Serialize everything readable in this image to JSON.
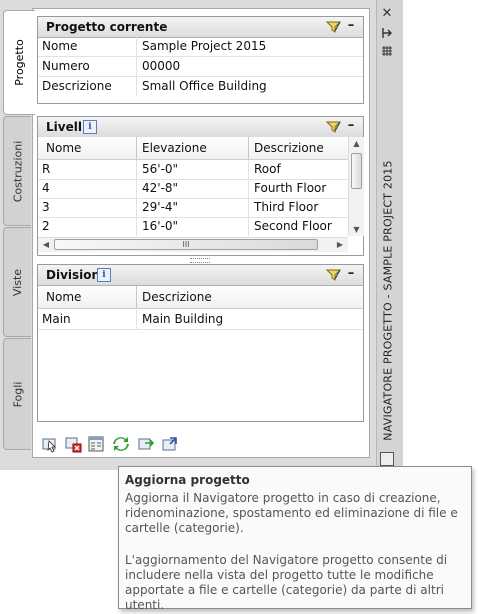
{
  "tabs": [
    {
      "label": "Progetto",
      "active": true
    },
    {
      "label": "Costruzioni",
      "active": false
    },
    {
      "label": "Viste",
      "active": false
    },
    {
      "label": "Fogli",
      "active": false
    }
  ],
  "palette_title": "NAVIGATORE PROGETTO - SAMPLE PROJECT 2015",
  "palette_icons": [
    "close-icon",
    "auto-hide-icon",
    "properties-icon"
  ],
  "current_project": {
    "title": "Progetto corrente",
    "rows": [
      {
        "key": "Nome",
        "value": "Sample Project 2015"
      },
      {
        "key": "Numero",
        "value": "00000"
      },
      {
        "key": "Descrizione",
        "value": "Small Office Building"
      }
    ]
  },
  "levels": {
    "title": "Livelli",
    "columns": [
      "Nome",
      "Elevazione",
      "Descrizione"
    ],
    "rows": [
      {
        "name": "R",
        "elevation": "56'-0\"",
        "description": "Roof"
      },
      {
        "name": "4",
        "elevation": "42'-8\"",
        "description": "Fourth Floor"
      },
      {
        "name": "3",
        "elevation": "29'-4\"",
        "description": "Third Floor"
      },
      {
        "name": "2",
        "elevation": "16'-0\"",
        "description": "Second Floor"
      }
    ],
    "h_scroll_thumb": "III"
  },
  "divisions": {
    "title": "Divisioni",
    "columns": [
      "Nome",
      "Descrizione"
    ],
    "rows": [
      {
        "name": "Main",
        "description": "Main Building"
      }
    ]
  },
  "toolbar_icons": [
    "select-project-icon",
    "close-project-icon",
    "project-browser-icon",
    "refresh-project-icon",
    "repath-project-icon",
    "project-standards-icon"
  ],
  "tooltip": {
    "title": "Aggiorna progetto",
    "body": "Aggiorna il Navigatore progetto in caso di creazione, ridenominazione, spostamento ed eliminazione di file e cartelle (categorie).",
    "body2": "L'aggiornamento del Navigatore progetto consente di includere nella vista del progetto tutte le modifiche apportate a file e cartelle (categorie) da parte di altri utenti."
  },
  "colors": {
    "accent_green": "#2e9e2e",
    "info_blue": "#2b58a0"
  }
}
